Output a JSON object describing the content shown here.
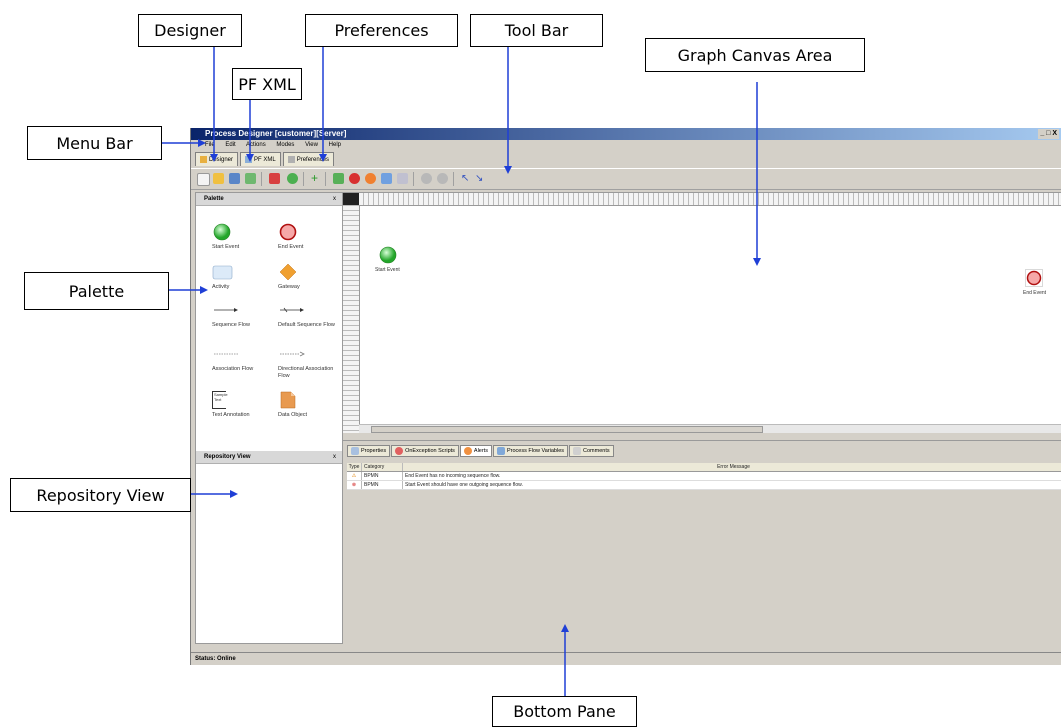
{
  "callouts": {
    "designer": "Designer",
    "preferences": "Preferences",
    "tool_bar": "Tool Bar",
    "pf_xml": "PF XML",
    "graph_canvas": "Graph Canvas Area",
    "menu_bar": "Menu Bar",
    "palette": "Palette",
    "repository_view": "Repository View",
    "bottom_pane": "Bottom Pane"
  },
  "window": {
    "title": "Process Designer [customer][Server]",
    "controls": "_ □ X"
  },
  "menu": [
    "File",
    "Edit",
    "Actions",
    "Modes",
    "View",
    "Help"
  ],
  "tabs": [
    "Designer",
    "PF XML",
    "Preferences"
  ],
  "palette": {
    "title": "Palette",
    "close": "x",
    "items": [
      {
        "label": "Start Event",
        "icon": "start-event-icon"
      },
      {
        "label": "End Event",
        "icon": "end-event-icon"
      },
      {
        "label": "Activity",
        "icon": "activity-icon"
      },
      {
        "label": "Gateway",
        "icon": "gateway-icon"
      },
      {
        "label": "Sequence Flow",
        "icon": "sequence-flow-icon"
      },
      {
        "label": "Default Sequence Flow",
        "icon": "default-sequence-flow-icon"
      },
      {
        "label": "Association Flow",
        "icon": "association-flow-icon"
      },
      {
        "label": "Directional Association Flow",
        "icon": "directional-association-flow-icon"
      },
      {
        "label": "Text Annotation",
        "icon": "text-annotation-icon"
      },
      {
        "label": "Data Object",
        "icon": "data-object-icon"
      }
    ],
    "sample_text": "Sample Text"
  },
  "repository": {
    "title": "Repository View",
    "close": "x"
  },
  "canvas": {
    "start_label": "Start Event",
    "end_label": "End Event"
  },
  "bottom_tabs": [
    "Properties",
    "OnException Scripts",
    "Alerts",
    "Process Flow Variables",
    "Comments"
  ],
  "alerts": {
    "headers": [
      "Type",
      "Category",
      "Error Message"
    ],
    "rows": [
      {
        "type": "warning",
        "category": "BPMN",
        "message": "End Event has no incoming sequence flow."
      },
      {
        "type": "error",
        "category": "BPMN",
        "message": "Start Event should have one outgoing sequence flow."
      }
    ]
  },
  "status": "Status: Online",
  "colors": {
    "arrow": "#1f3fd6",
    "titlebar": "#0a246a"
  }
}
